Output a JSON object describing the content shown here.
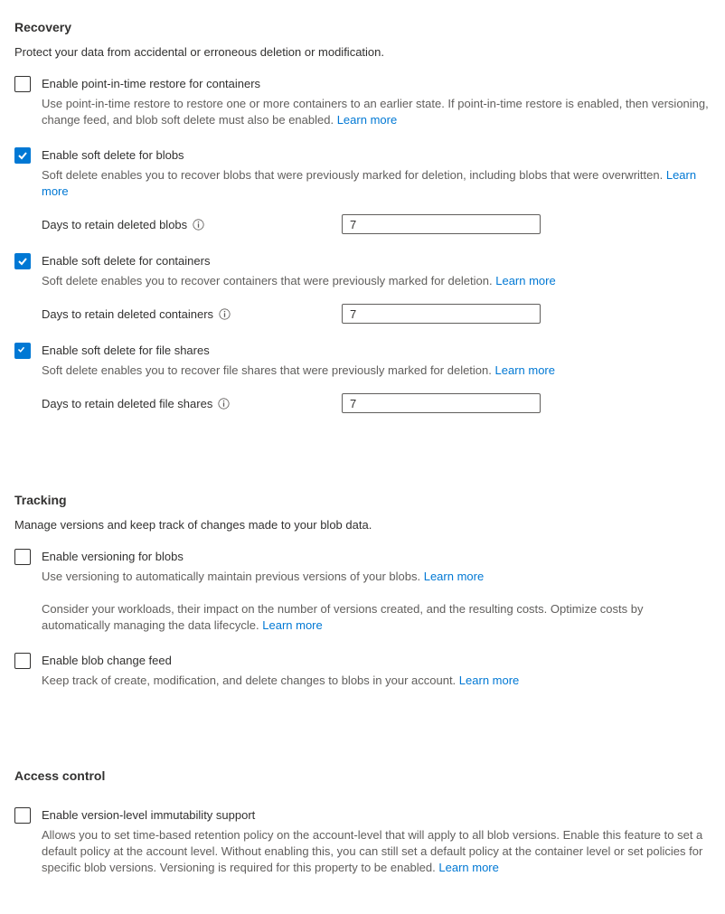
{
  "common": {
    "learn_more": "Learn more"
  },
  "recovery": {
    "header": "Recovery",
    "intro": "Protect your data from accidental or erroneous deletion or modification.",
    "pitr": {
      "label": "Enable point-in-time restore for containers",
      "desc_1": "Use point-in-time restore to restore one or more containers to an earlier state. If point-in-time restore is enabled, then versioning, change feed, and blob soft delete must also be enabled.",
      "checked": "false"
    },
    "soft_delete_blobs": {
      "label": "Enable soft delete for blobs",
      "desc_1": "Soft delete enables you to recover blobs that were previously marked for deletion, including blobs that were overwritten.",
      "checked": "true",
      "field_label": "Days to retain deleted blobs",
      "value": "7"
    },
    "soft_delete_containers": {
      "label": "Enable soft delete for containers",
      "desc_1": "Soft delete enables you to recover containers that were previously marked for deletion.",
      "checked": "true",
      "field_label": "Days to retain deleted containers",
      "value": "7"
    },
    "soft_delete_file_shares": {
      "label": "Enable soft delete for file shares",
      "desc_1": "Soft delete enables you to recover file shares that were previously marked for deletion.",
      "checked": "true",
      "field_label": "Days to retain deleted file shares",
      "value": "7"
    }
  },
  "tracking": {
    "header": "Tracking",
    "intro": "Manage versions and keep track of changes made to your blob data.",
    "versioning": {
      "label": "Enable versioning for blobs",
      "desc_1": "Use versioning to automatically maintain previous versions of your blobs.",
      "desc_2": "Consider your workloads, their impact on the number of versions created, and the resulting costs. Optimize costs by automatically managing the data lifecycle.",
      "checked": "false"
    },
    "change_feed": {
      "label": "Enable blob change feed",
      "desc_1": "Keep track of create, modification, and delete changes to blobs in your account.",
      "checked": "false"
    }
  },
  "access_control": {
    "header": "Access control",
    "immutability": {
      "label": "Enable version-level immutability support",
      "desc_1": "Allows you to set time-based retention policy on the account-level that will apply to all blob versions. Enable this feature to set a default policy at the account level. Without enabling this, you can still set a default policy at the container level or set policies for specific blob versions. Versioning is required for this property to be enabled.",
      "checked": "false"
    }
  }
}
